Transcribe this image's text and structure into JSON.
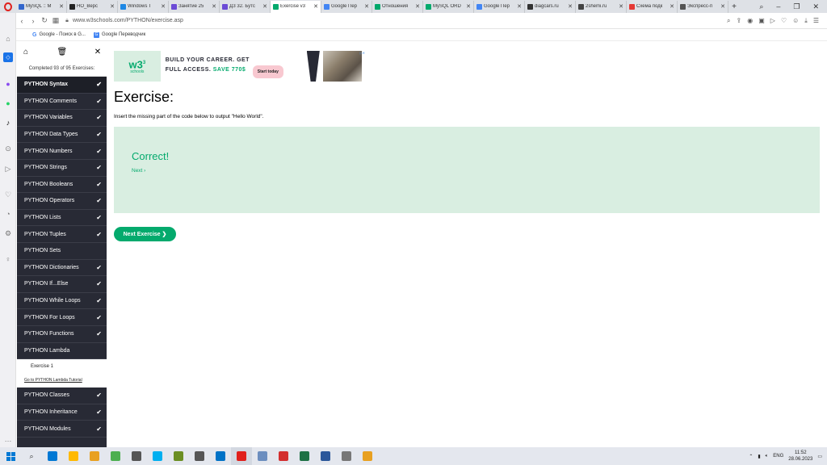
{
  "browser": {
    "tabs": [
      {
        "label": "MySQL :: M",
        "color": "#3366cc"
      },
      {
        "label": "HO_Верс",
        "color": "#222222"
      },
      {
        "label": "Windows T",
        "color": "#1e88e5"
      },
      {
        "label": "Занятие 25",
        "color": "#6c4bd6"
      },
      {
        "label": "ДЗ 32. Бутс",
        "color": "#6c4bd6"
      },
      {
        "label": "Exercise v3",
        "color": "#04aa6d",
        "active": true
      },
      {
        "label": "Google Пер",
        "color": "#4285f4"
      },
      {
        "label": "Отношения",
        "color": "#00a86b"
      },
      {
        "label": "MySQL ORD",
        "color": "#04aa6d"
      },
      {
        "label": "Google Пер",
        "color": "#4285f4"
      },
      {
        "label": "diagcars.ru",
        "color": "#333333"
      },
      {
        "label": "2shemi.ru",
        "color": "#444444"
      },
      {
        "label": "Схема подк",
        "color": "#e53935"
      },
      {
        "label": "Экспресс-п",
        "color": "#555555"
      }
    ],
    "url": "www.w3schools.com/PYTHON/exercise.asp",
    "bookmarks": [
      "Google - Поиск в G...",
      "Google Переводчик"
    ]
  },
  "sidebar": {
    "completed_text": "Completed 93 of 95 Exercises:",
    "categories": [
      {
        "label": "PYTHON Syntax",
        "done": true
      },
      {
        "label": "PYTHON Comments",
        "done": true
      },
      {
        "label": "PYTHON Variables",
        "done": true
      },
      {
        "label": "PYTHON Data Types",
        "done": true
      },
      {
        "label": "PYTHON Numbers",
        "done": true
      },
      {
        "label": "PYTHON Strings",
        "done": true
      },
      {
        "label": "PYTHON Booleans",
        "done": true
      },
      {
        "label": "PYTHON Operators",
        "done": true
      },
      {
        "label": "PYTHON Lists",
        "done": true
      },
      {
        "label": "PYTHON Tuples",
        "done": true
      },
      {
        "label": "PYTHON Sets",
        "done": false
      },
      {
        "label": "PYTHON Dictionaries",
        "done": true
      },
      {
        "label": "PYTHON If...Else",
        "done": true
      },
      {
        "label": "PYTHON While Loops",
        "done": true
      },
      {
        "label": "PYTHON For Loops",
        "done": true
      },
      {
        "label": "PYTHON Functions",
        "done": true
      },
      {
        "label": "PYTHON Lambda",
        "done": false
      }
    ],
    "sub": {
      "exercise": "Exercise 1",
      "goto": "Go to PYTHON Lambda Tutorial"
    },
    "after": [
      {
        "label": "PYTHON Classes",
        "done": true
      },
      {
        "label": "PYTHON Inheritance",
        "done": true
      },
      {
        "label": "PYTHON Modules",
        "done": true
      }
    ]
  },
  "banner": {
    "logo": "w3",
    "logo_sup": "3",
    "logo_sub": "schools",
    "line1": "BUILD YOUR CAREER. GET",
    "line2": "FULL ACCESS.",
    "save": "SAVE 770$",
    "cta": "Start today"
  },
  "main": {
    "title": "Exercise:",
    "instruction": "Insert the missing part of the code below to output \"Hello World\".",
    "correct": "Correct!",
    "next_link": "Next ›",
    "next_exercise": "Next Exercise ❯"
  },
  "taskbar": {
    "lang": "ENG",
    "time": "11:52",
    "date": "28.06.2023",
    "apps": [
      "#0078d4",
      "#ffb900",
      "#e8a020",
      "#4caf50",
      "#555555",
      "#00aff0",
      "#6b8e23",
      "#555555",
      "#0072c6",
      "#e0201c",
      "#6c8ebf",
      "#d32f2f",
      "#1e7145",
      "#2b579a",
      "#777777",
      "#e8a020"
    ]
  }
}
